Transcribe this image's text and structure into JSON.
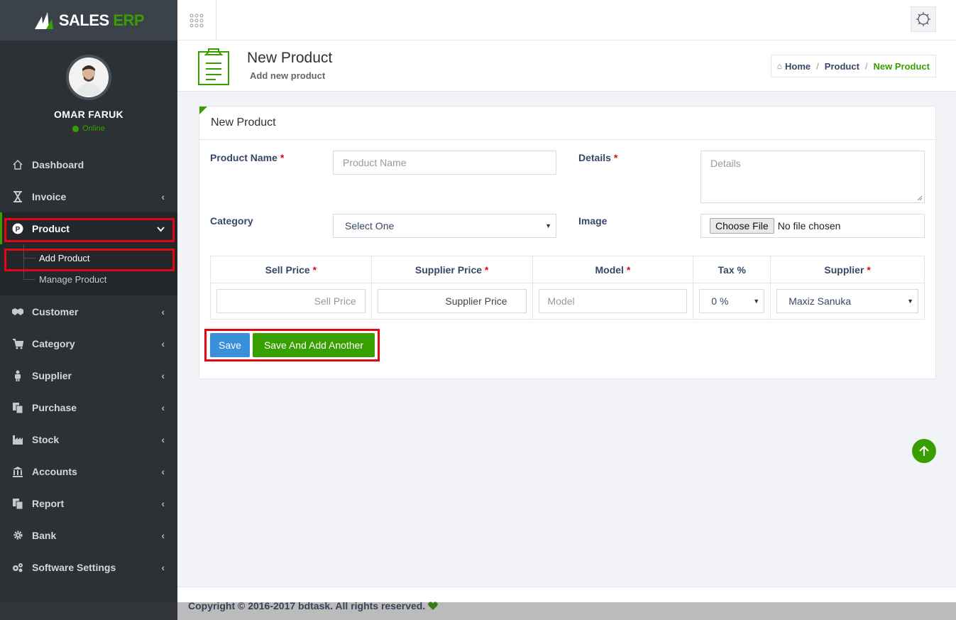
{
  "brand": {
    "name_part1": "SALES",
    "name_part2": "ERP",
    "accent": "#37a000"
  },
  "user": {
    "name": "OMAR FARUK",
    "status": "Online"
  },
  "sidebar": {
    "items": [
      {
        "label": "Dashboard",
        "icon": "home-icon"
      },
      {
        "label": "Invoice",
        "icon": "hourglass-icon"
      },
      {
        "label": "Product",
        "icon": "product-badge-icon",
        "active": true
      },
      {
        "label": "Customer",
        "icon": "handshake-icon"
      },
      {
        "label": "Category",
        "icon": "cart-icon"
      },
      {
        "label": "Supplier",
        "icon": "person-icon"
      },
      {
        "label": "Purchase",
        "icon": "copy-icon"
      },
      {
        "label": "Stock",
        "icon": "factory-icon"
      },
      {
        "label": "Accounts",
        "icon": "bank-icon"
      },
      {
        "label": "Report",
        "icon": "copy-icon"
      },
      {
        "label": "Bank",
        "icon": "gear-icon"
      },
      {
        "label": "Software Settings",
        "icon": "gears-icon"
      }
    ],
    "product_sub": [
      {
        "label": "Add Product",
        "active": true
      },
      {
        "label": "Manage Product"
      }
    ]
  },
  "page": {
    "title": "New Product",
    "subtitle": "Add new product",
    "breadcrumb": {
      "home": "Home",
      "section": "Product",
      "current": "New Product"
    }
  },
  "form": {
    "heading": "New Product",
    "product_name": {
      "label": "Product Name",
      "placeholder": "Product Name"
    },
    "details": {
      "label": "Details",
      "placeholder": "Details"
    },
    "category": {
      "label": "Category",
      "value": "Select One"
    },
    "image": {
      "label": "Image",
      "button": "Choose File",
      "status": "No file chosen"
    },
    "required_mark": "*",
    "table": {
      "headers": {
        "sell_price": "Sell Price",
        "supplier_price": "Supplier Price",
        "model": "Model",
        "tax": "Tax %",
        "supplier": "Supplier"
      },
      "sell_price_placeholder": "Sell Price",
      "supplier_price_placeholder": "Supplier Price",
      "model_placeholder": "Model",
      "tax_value": "0 %",
      "supplier_value": "Maxiz Sanuka"
    },
    "buttons": {
      "save": "Save",
      "save_add": "Save And Add Another"
    }
  },
  "footer": {
    "text": "Copyright © 2016-2017 bdtask. All rights reserved."
  }
}
